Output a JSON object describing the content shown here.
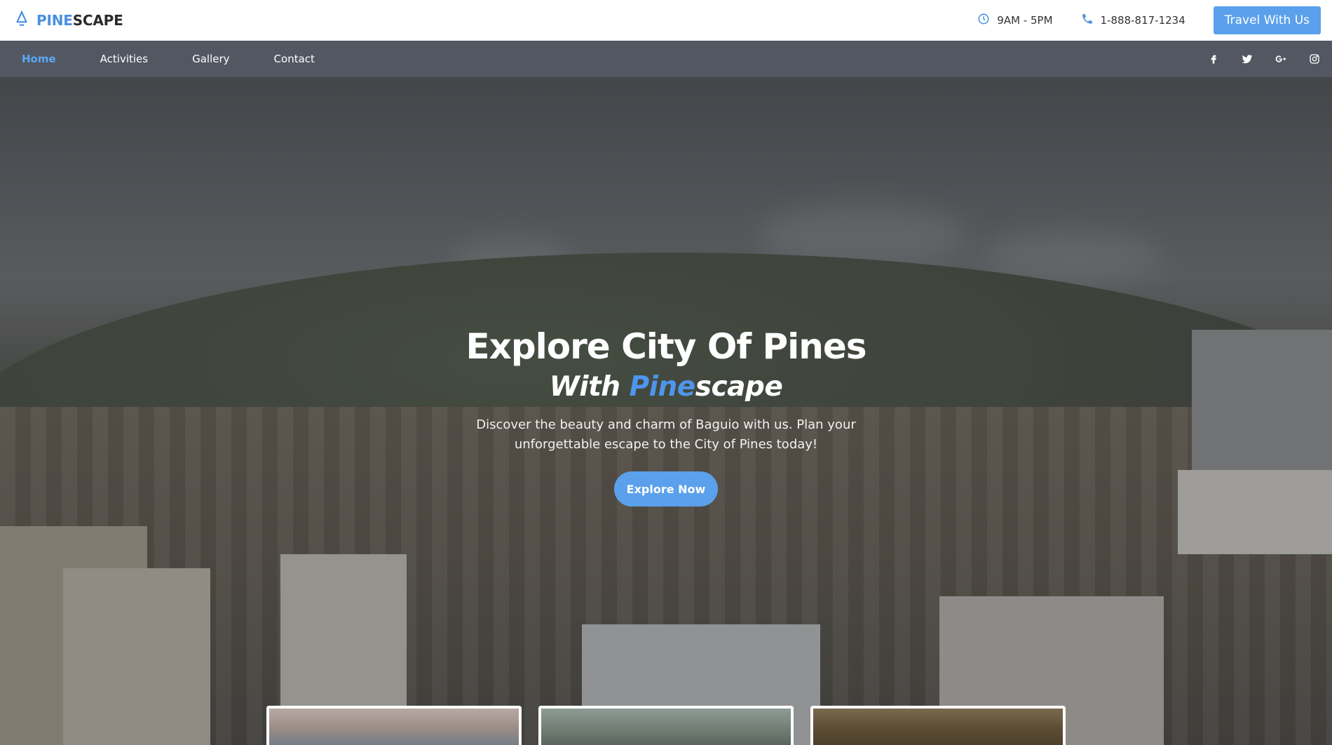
{
  "brand": {
    "accent": "PINE",
    "rest": "SCAPE",
    "logo_icon": "bell-tree-icon",
    "accent_color": "#4a90e2"
  },
  "header": {
    "hours": "9AM - 5PM",
    "hours_icon": "clock-icon",
    "phone": "1-888-817-1234",
    "phone_icon": "phone-icon",
    "cta_label": "Travel With Us",
    "cta_color": "#5ba0ec"
  },
  "nav": {
    "links": [
      {
        "label": "Home",
        "active": true
      },
      {
        "label": "Activities",
        "active": false
      },
      {
        "label": "Gallery",
        "active": false
      },
      {
        "label": "Contact",
        "active": false
      }
    ],
    "socials": [
      "facebook-icon",
      "twitter-icon",
      "google-plus-icon",
      "instagram-icon"
    ],
    "background": "#525762",
    "active_color": "#5ba8f5"
  },
  "hero": {
    "title": "Explore City Of Pines",
    "subtitle_prefix": "With ",
    "subtitle_accent": "Pine",
    "subtitle_suffix": "scape",
    "description": "Discover the beauty and charm of Baguio with us. Plan your unforgettable escape to the City of Pines today!",
    "button_label": "Explore Now"
  }
}
